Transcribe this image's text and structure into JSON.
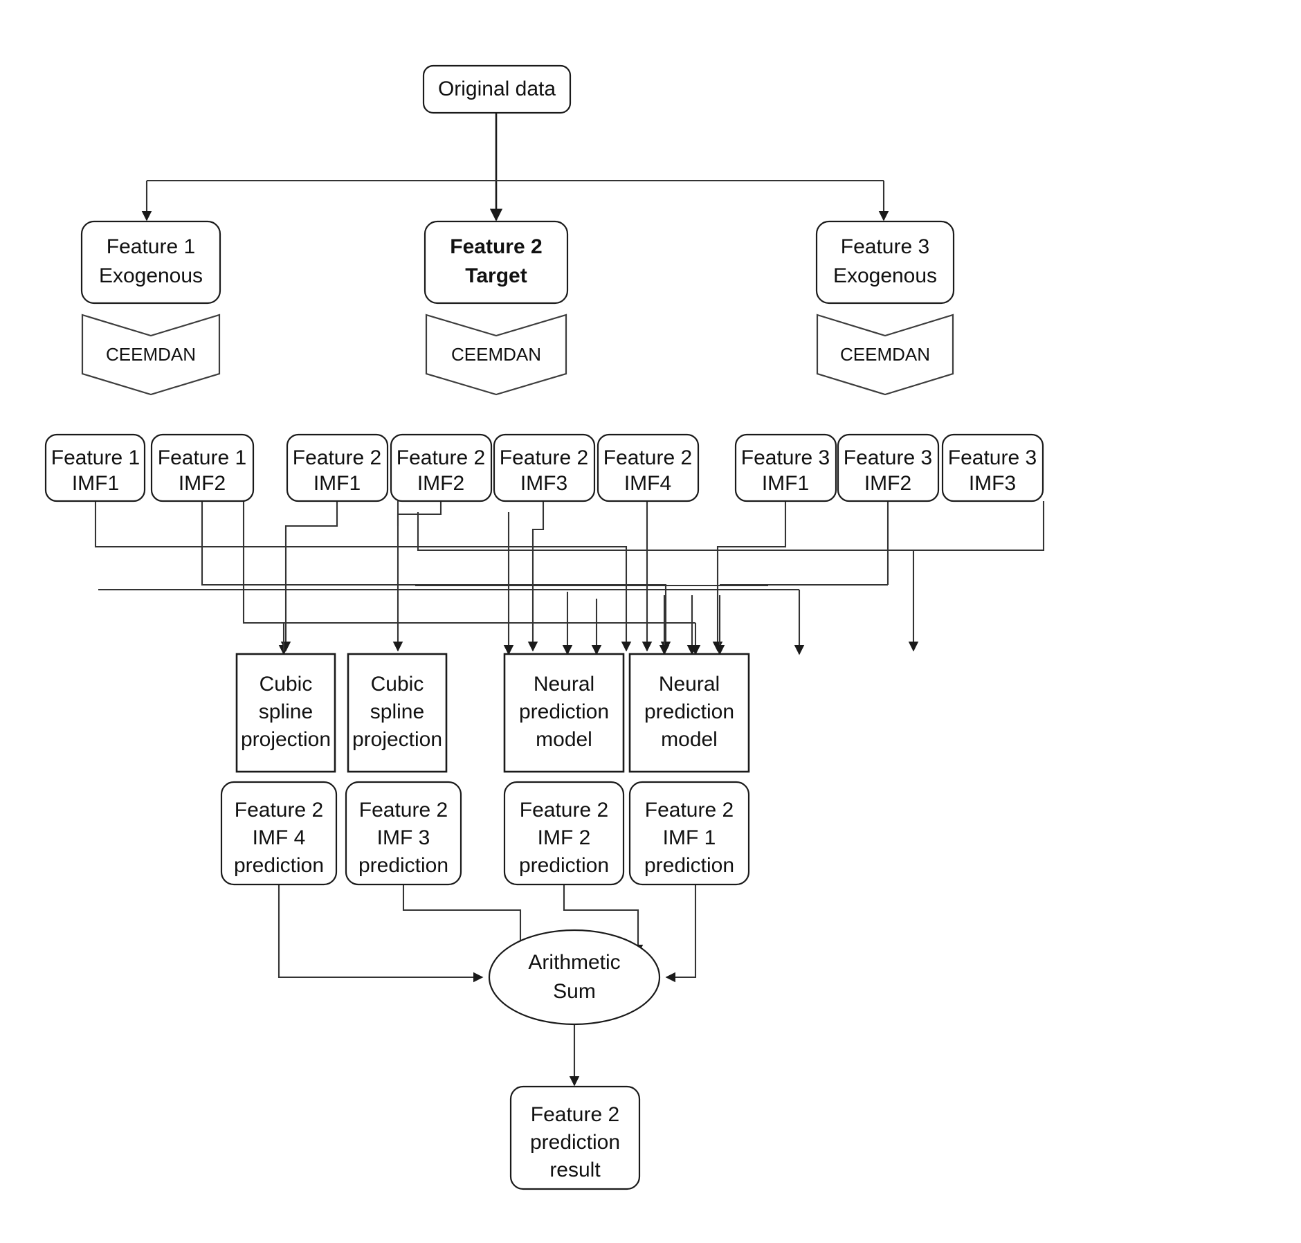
{
  "diagram": {
    "title": "CEEMDAN multi-feature decomposition and prediction flowchart",
    "colors": {
      "background": "#ffffff",
      "node_stroke": "#1a1a1a",
      "edge_stroke": "#333333",
      "text": "#111111"
    },
    "nodes": {
      "original_data": {
        "label": "Original data"
      },
      "feature1_source": {
        "line1": "Feature 1",
        "line2": "Exogenous"
      },
      "feature2_source": {
        "line1": "Feature 2",
        "line2": "Target"
      },
      "feature3_source": {
        "line1": "Feature 3",
        "line2": "Exogenous"
      },
      "ceemdan_1": {
        "label": "CEEMDAN"
      },
      "ceemdan_2": {
        "label": "CEEMDAN"
      },
      "ceemdan_3": {
        "label": "CEEMDAN"
      },
      "imfs": [
        {
          "line1": "Feature 1",
          "line2": "IMF1"
        },
        {
          "line1": "Feature 1",
          "line2": "IMF2"
        },
        {
          "line1": "Feature 2",
          "line2": "IMF1"
        },
        {
          "line1": "Feature 2",
          "line2": "IMF2"
        },
        {
          "line1": "Feature 2",
          "line2": "IMF3"
        },
        {
          "line1": "Feature 2",
          "line2": "IMF4"
        },
        {
          "line1": "Feature 3",
          "line2": "IMF1"
        },
        {
          "line1": "Feature 3",
          "line2": "IMF2"
        },
        {
          "line1": "Feature 3",
          "line2": "IMF3"
        }
      ],
      "models": [
        {
          "line1": "Cubic",
          "line2": "spline",
          "line3": "projection"
        },
        {
          "line1": "Cubic",
          "line2": "spline",
          "line3": "projection"
        },
        {
          "line1": "Neural",
          "line2": "prediction",
          "line3": "model"
        },
        {
          "line1": "Neural",
          "line2": "prediction",
          "line3": "model"
        }
      ],
      "predictions": [
        {
          "line1": "Feature 2",
          "line2": "IMF 4",
          "line3": "prediction"
        },
        {
          "line1": "Feature 2",
          "line2": "IMF 3",
          "line3": "prediction"
        },
        {
          "line1": "Feature 2",
          "line2": "IMF 2",
          "line3": "prediction"
        },
        {
          "line1": "Feature 2",
          "line2": "IMF 1",
          "line3": "prediction"
        }
      ],
      "arithmetic_sum": {
        "line1": "Arithmetic",
        "line2": "Sum"
      },
      "final_result": {
        "line1": "Feature 2",
        "line2": "prediction",
        "line3": "result"
      }
    }
  }
}
